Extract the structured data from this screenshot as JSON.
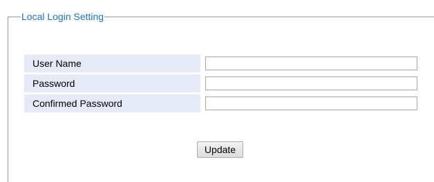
{
  "fieldset": {
    "legend": "Local Login Setting"
  },
  "form": {
    "rows": [
      {
        "label": "User Name",
        "value": ""
      },
      {
        "label": "Password",
        "value": ""
      },
      {
        "label": "Confirmed Password",
        "value": ""
      }
    ],
    "update_label": "Update"
  },
  "colors": {
    "legend_text": "#1b72c9",
    "label_background": "#e6e9f6",
    "frame_border": "#999999"
  }
}
